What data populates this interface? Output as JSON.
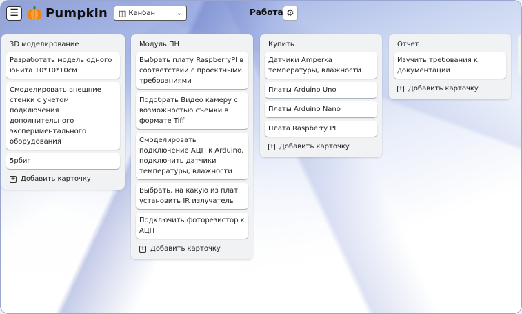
{
  "header": {
    "logo_text": "Pumpkin",
    "view_select": "Канбан",
    "board_title": "Работа"
  },
  "lists": [
    {
      "title": "3D моделирование",
      "cards": [
        "Разработать модель одного юнита 10*10*10см",
        "Смоделировать внешние стенки с учетом подключения дополнительного экспериментального оборудования",
        "5рбиг"
      ],
      "add_label": "Добавить карточку"
    },
    {
      "title": "Модуль ПН",
      "cards": [
        "Выбрать плату RaspberryPI в соответствии с проектными требованиями",
        "Подобрать Видео камеру с возможностью съемки в формате Tiff",
        "Смоделировать подключение АЦП к Arduino, подключить датчики температуры, влажности",
        "Выбрать, на какую из плат установить IR излучатель",
        "Подключить фоторезистор к АЦП"
      ],
      "add_label": "Добавить карточку"
    },
    {
      "title": "Купить",
      "cards": [
        "Датчики Amperka температуры, влажности",
        "Платы Arduino Uno",
        "Платы Arduino Nano",
        "Плата Raspberry PI"
      ],
      "add_label": "Добавить карточку"
    },
    {
      "title": "Отчет",
      "cards": [
        "Изучить требования к документации"
      ],
      "add_label": "Добавить карточку"
    }
  ]
}
